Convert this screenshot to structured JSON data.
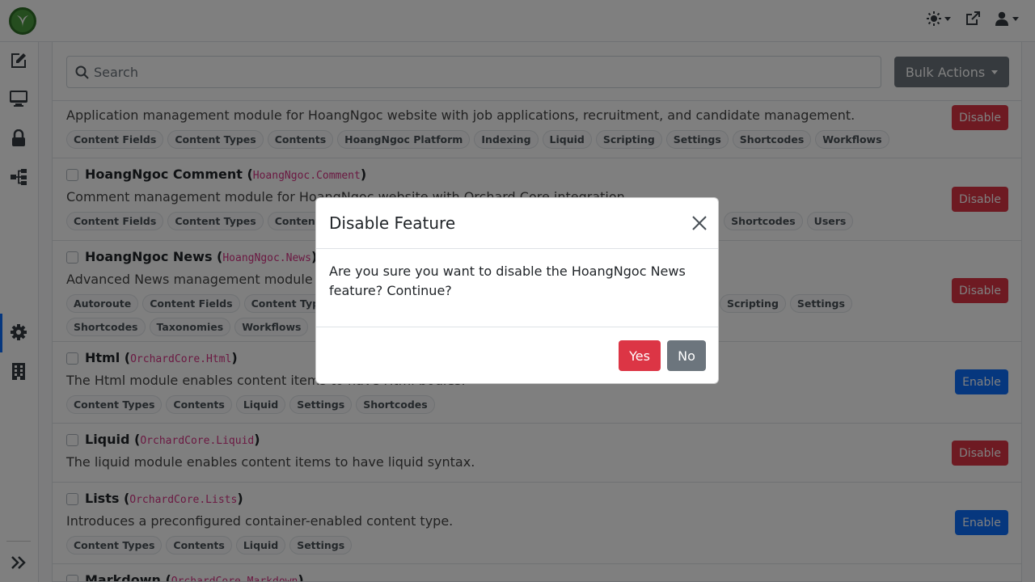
{
  "search": {
    "placeholder": "Search"
  },
  "bulk_actions_label": "Bulk Actions",
  "features": [
    {
      "description": "Application management module for HoangNgoc website with job applications, recruitment, and candidate management.",
      "tags": [
        "Content Fields",
        "Content Types",
        "Contents",
        "HoangNgoc Platform",
        "Indexing",
        "Liquid",
        "Scripting",
        "Settings",
        "Shortcodes",
        "Workflows"
      ],
      "button": "Disable"
    },
    {
      "name": "HoangNgoc Comment",
      "id": "HoangNgoc.Comment",
      "description": "Comment management module for HoangNgoc website with Orchard Core integration.",
      "tags": [
        "Content Fields",
        "Content Types",
        "Contents",
        "Shortcodes",
        "Users"
      ],
      "button": "Disable"
    },
    {
      "name": "HoangNgoc News",
      "id": "HoangNgoc.News",
      "description": "Advanced News management module",
      "tags": [
        "Autoroute",
        "Content Fields",
        "Content Types",
        "Scripting",
        "Settings",
        "Shortcodes",
        "Taxonomies",
        "Workflows"
      ],
      "button": "Disable"
    },
    {
      "name": "Html",
      "id": "OrchardCore.Html",
      "description": "The Html module enables content items to have Html bodies.",
      "tags": [
        "Content Types",
        "Contents",
        "Liquid",
        "Settings",
        "Shortcodes"
      ],
      "button": "Enable"
    },
    {
      "name": "Liquid",
      "id": "OrchardCore.Liquid",
      "description": "The liquid module enables content items to have liquid syntax.",
      "tags": [],
      "button": "Disable"
    },
    {
      "name": "Lists",
      "id": "OrchardCore.Lists",
      "description": "Introduces a preconfigured container-enabled content type.",
      "tags": [
        "Content Types",
        "Contents",
        "Liquid",
        "Settings"
      ],
      "button": "Enable"
    },
    {
      "name": "Markdown",
      "id": "OrchardCore.Markdown",
      "description": "",
      "tags": [],
      "button": ""
    }
  ],
  "modal": {
    "title": "Disable Feature",
    "body": "Are you sure you want to disable the HoangNgoc News feature? Continue?",
    "yes_label": "Yes",
    "no_label": "No"
  },
  "colors": {
    "danger": "#dc3545",
    "primary": "#0d6efd",
    "secondary": "#6c757d",
    "code": "#d63384"
  }
}
